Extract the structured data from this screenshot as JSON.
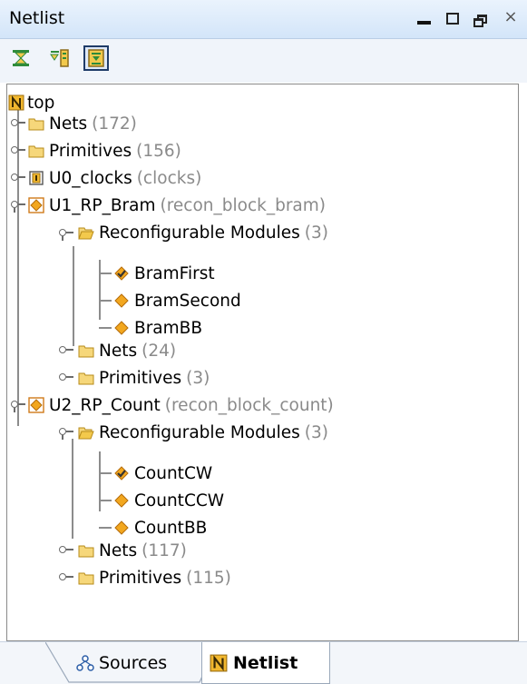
{
  "panel": {
    "title": "Netlist"
  },
  "window_controls": {
    "minimize": "minimize",
    "maximize": "maximize",
    "restore": "restore",
    "close": "×"
  },
  "toolbar": {
    "buttons": [
      "collapse-all",
      "expand-all",
      "show-hierarchy"
    ]
  },
  "tree": {
    "root": {
      "label": "top"
    },
    "nodes": [
      {
        "label": "Nets",
        "count": "(172)"
      },
      {
        "label": "Primitives",
        "count": "(156)"
      },
      {
        "label": "U0_clocks",
        "count": "(clocks)"
      },
      {
        "label": "U1_RP_Bram",
        "count": "(recon_block_bram)"
      },
      {
        "label": "Reconfigurable Modules",
        "count": "(3)"
      },
      {
        "label": "BramFirst",
        "count": ""
      },
      {
        "label": "BramSecond",
        "count": ""
      },
      {
        "label": "BramBB",
        "count": ""
      },
      {
        "label": "Nets",
        "count": "(24)"
      },
      {
        "label": "Primitives",
        "count": "(3)"
      },
      {
        "label": "U2_RP_Count",
        "count": "(recon_block_count)"
      },
      {
        "label": "Reconfigurable Modules",
        "count": "(3)"
      },
      {
        "label": "CountCW",
        "count": ""
      },
      {
        "label": "CountCCW",
        "count": ""
      },
      {
        "label": "CountBB",
        "count": ""
      },
      {
        "label": "Nets",
        "count": "(117)"
      },
      {
        "label": "Primitives",
        "count": "(115)"
      }
    ]
  },
  "tabs": [
    {
      "label": "Sources"
    },
    {
      "label": "Netlist"
    }
  ],
  "colors": {
    "folder": "#f1c94f",
    "module": "#f0b429",
    "accent": "#1f3b68"
  }
}
